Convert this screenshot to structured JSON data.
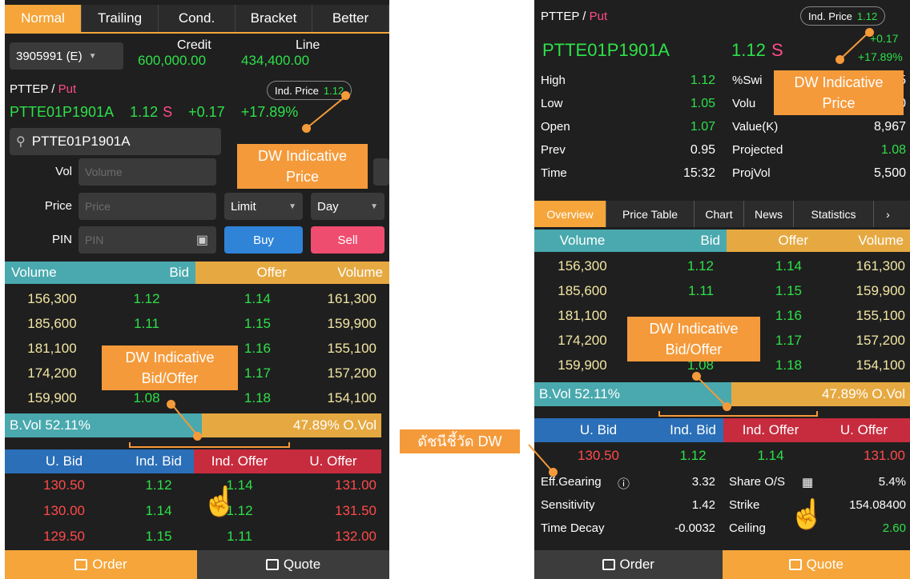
{
  "left": {
    "tabs": [
      "Normal",
      "Trailing",
      "Cond.",
      "Bracket",
      "Better"
    ],
    "account": "3905991 (E)",
    "credit_label": "Credit",
    "credit_value": "600,000.00",
    "line_label": "Line",
    "line_value": "434,400.00",
    "underlying": "PTTEP",
    "slash": " / ",
    "put_label": "Put",
    "ind_price_label": "Ind. Price",
    "ind_price_value": "1.12",
    "symbol": "PTTE01P1901A",
    "price": "1.12",
    "side": "S",
    "change": "+0.17",
    "pct_change": "+17.89%",
    "search_value": "PTTE01P1901A",
    "vol_label": "Vol",
    "vol_placeholder": "Volume",
    "price_label": "Price",
    "price_placeholder": "Price",
    "limit_label": "Limit",
    "day_label": "Day",
    "pin_label": "PIN",
    "pin_placeholder": "PIN",
    "buy_label": "Buy",
    "sell_label": "Sell",
    "book_headers": [
      "Volume",
      "Bid",
      "Offer",
      "Volume"
    ],
    "book_rows": [
      [
        "156,300",
        "1.12",
        "1.14",
        "161,300"
      ],
      [
        "185,600",
        "1.11",
        "1.15",
        "159,900"
      ],
      [
        "181,100",
        "",
        "1.16",
        "155,100"
      ],
      [
        "174,200",
        "",
        "1.17",
        "157,200"
      ],
      [
        "159,900",
        "1.08",
        "1.18",
        "154,100"
      ]
    ],
    "bvol": "B.Vol 52.11%",
    "ovol": "47.89% O.Vol",
    "u_headers": [
      "U. Bid",
      "Ind. Bid",
      "Ind. Offer",
      "U. Offer"
    ],
    "u_rows": [
      [
        "130.50",
        "1.12",
        "1.14",
        "131.00"
      ],
      [
        "130.00",
        "1.14",
        "1.12",
        "131.50"
      ],
      [
        "129.50",
        "1.15",
        "1.11",
        "132.00"
      ]
    ],
    "nav_order": "Order",
    "nav_quote": "Quote"
  },
  "right": {
    "underlying": "PTTEP",
    "slash": " / ",
    "put_label": "Put",
    "ind_price_label": "Ind. Price",
    "ind_price_value": "1.12",
    "change": "+0.17",
    "symbol": "PTTE01P1901A",
    "price": "1.12",
    "side": "S",
    "pct_change": "+17.89%",
    "stats_left": [
      {
        "label": "High",
        "value": "1.12"
      },
      {
        "label": "Low",
        "value": "1.05"
      },
      {
        "label": "Open",
        "value": "1.07"
      },
      {
        "label": "Prev",
        "value": "0.95"
      },
      {
        "label": "Time",
        "value": "15:32"
      }
    ],
    "stats_right": [
      {
        "label": "%Swi",
        "value": "5"
      },
      {
        "label": "Volu",
        "value": "0"
      },
      {
        "label": "Value(K)",
        "value": "8,967"
      },
      {
        "label": "Projected",
        "value": "1.08"
      },
      {
        "label": "ProjVol",
        "value": "5,500"
      }
    ],
    "tabs": [
      "Overview",
      "Price Table",
      "Chart",
      "News",
      "Statistics"
    ],
    "book_headers": [
      "Volume",
      "Bid",
      "Offer",
      "Volume"
    ],
    "book_rows": [
      [
        "156,300",
        "1.12",
        "1.14",
        "161,300"
      ],
      [
        "185,600",
        "1.11",
        "1.15",
        "159,900"
      ],
      [
        "181,100",
        "",
        "1.16",
        "155,100"
      ],
      [
        "174,200",
        "",
        "1.17",
        "157,200"
      ],
      [
        "159,900",
        "1.08",
        "1.18",
        "154,100"
      ]
    ],
    "bvol": "B.Vol 52.11%",
    "ovol": "47.89% O.Vol",
    "u_headers": [
      "U. Bid",
      "Ind. Bid",
      "Ind. Offer",
      "U. Offer"
    ],
    "u_row": [
      "130.50",
      "1.12",
      "1.14",
      "131.00"
    ],
    "extra": [
      {
        "label": "Eff.Gearing",
        "value": "3.32",
        "label2": "Share O/S",
        "value2": "5.4%"
      },
      {
        "label": "Sensitivity",
        "value": "1.42",
        "label2": "Strike",
        "value2": "154.08400"
      },
      {
        "label": "Time Decay",
        "value": "-0.0032",
        "label2": "Ceiling",
        "value2": "2.60"
      }
    ],
    "nav_order": "Order",
    "nav_quote": "Quote"
  },
  "callouts": {
    "dw_price_line1": "DW Indicative",
    "dw_price_line2": "Price",
    "dw_bidoffer_line1": "DW Indicative",
    "dw_bidoffer_line2": "Bid/Offer",
    "dw_index": "ดัชนีชี้วัด DW",
    "r_price_line1": "DW Indicative",
    "r_price_line2": "Price",
    "r_bidoffer_line1": "DW Indicative",
    "r_bidoffer_line2": "Bid/Offer"
  },
  "colors": {
    "accent": "#f5a53a",
    "teal": "#49a9ae",
    "gold": "#e6a941",
    "blue": "#2a6fb8",
    "red": "#c72b3e",
    "green": "#2ee04a"
  }
}
